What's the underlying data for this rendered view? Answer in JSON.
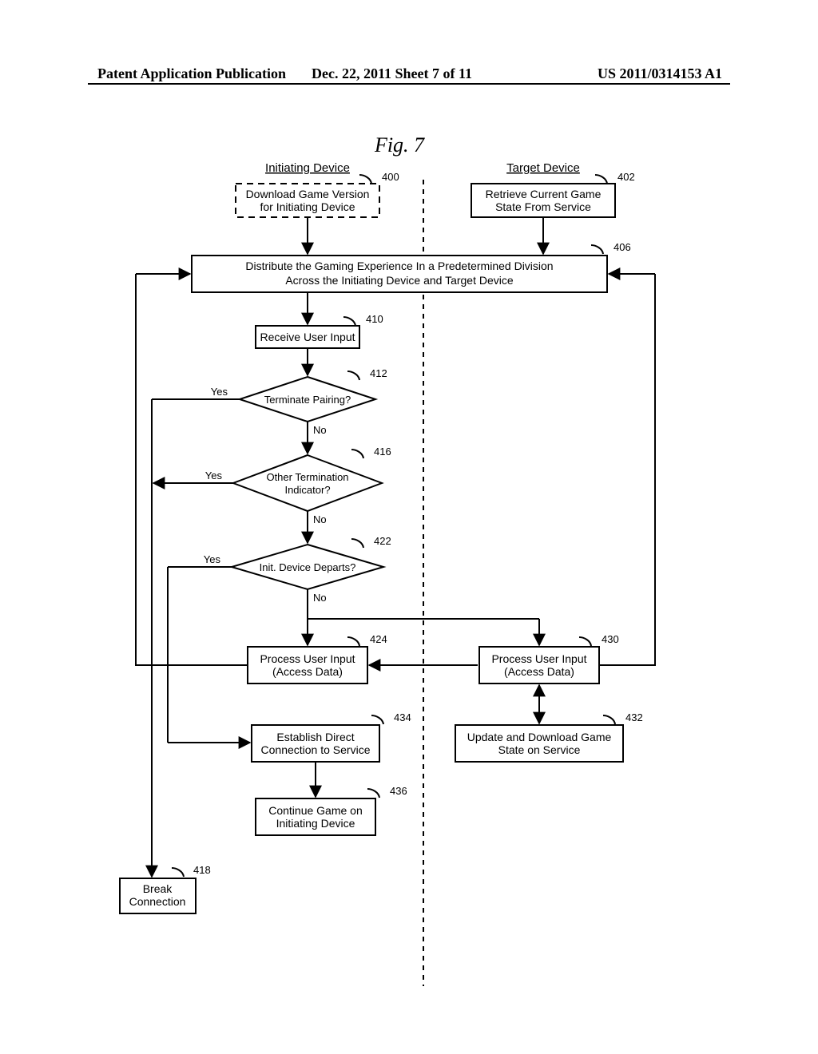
{
  "header": {
    "left": "Patent Application Publication",
    "center": "Dec. 22, 2011  Sheet 7 of 11",
    "right": "US 2011/0314153 A1"
  },
  "figure_title": "Fig. 7",
  "columns": {
    "initiating": "Initiating Device",
    "target": "Target Device"
  },
  "boxes": {
    "b400": {
      "ref": "400",
      "line1": "Download Game Version",
      "line2": "for Initiating Device"
    },
    "b402": {
      "ref": "402",
      "line1": "Retrieve Current Game",
      "line2": "State From Service"
    },
    "b406": {
      "ref": "406",
      "line1": "Distribute the Gaming Experience In a Predetermined Division",
      "line2": "Across the Initiating Device and Target Device"
    },
    "b410": {
      "ref": "410",
      "line1": "Receive User Input"
    },
    "b412": {
      "ref": "412",
      "line1": "Terminate Pairing?"
    },
    "b416": {
      "ref": "416",
      "line1": "Other Termination",
      "line2": "Indicator?"
    },
    "b422": {
      "ref": "422",
      "line1": "Init. Device Departs?"
    },
    "b424": {
      "ref": "424",
      "line1": "Process User Input",
      "line2": "(Access Data)"
    },
    "b430": {
      "ref": "430",
      "line1": "Process User Input",
      "line2": "(Access Data)"
    },
    "b432": {
      "ref": "432",
      "line1": "Update and Download Game",
      "line2": "State on Service"
    },
    "b434": {
      "ref": "434",
      "line1": "Establish Direct",
      "line2": "Connection to Service"
    },
    "b436": {
      "ref": "436",
      "line1": "Continue Game on",
      "line2": "Initiating Device"
    },
    "b418": {
      "ref": "418",
      "line1": "Break",
      "line2": "Connection"
    }
  },
  "labels": {
    "yes": "Yes",
    "no": "No"
  }
}
